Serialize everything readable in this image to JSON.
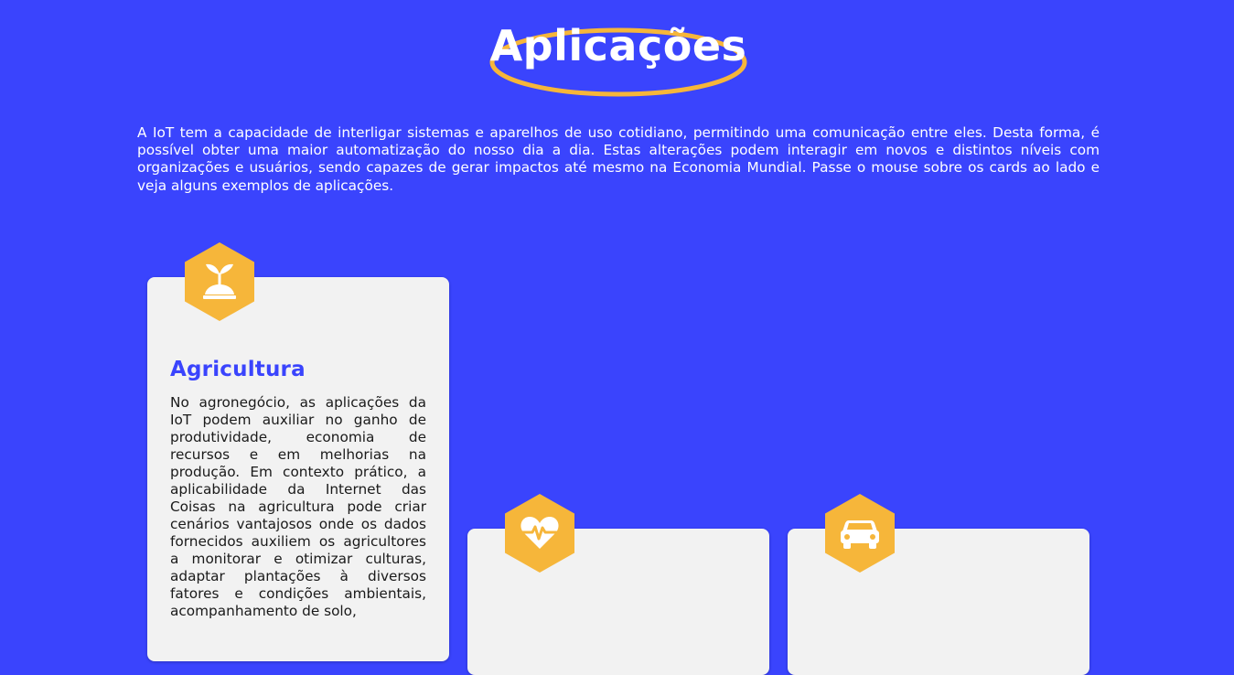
{
  "section": {
    "title": "Aplicações",
    "intro": "A IoT tem a capacidade de interligar sistemas e aparelhos de uso cotidiano, permitindo uma comunicação entre eles. Desta forma, é possível obter uma maior automatização do nosso dia a dia. Estas alterações podem interagir em novos e distintos níveis com organizações e usuários, sendo capazes de gerar impactos até mesmo na Economia Mundial. Passe o mouse sobre os cards ao lado e veja alguns exemplos de aplicações."
  },
  "cards": [
    {
      "icon": "sprout-icon",
      "title": "Agricultura",
      "text": "No agronegócio, as aplicações da IoT podem auxiliar no ganho de produtividade, economia de recursos e em melhorias na produção. Em contexto prático, a aplicabilidade da Internet das Coisas na agricultura pode criar cenários vantajosos onde os dados fornecidos auxiliem os agricultores a monitorar e otimizar culturas, adaptar plantações à diversos fatores e condições ambientais, acompanhamento de solo,"
    },
    {
      "icon": "heart-pulse-icon"
    },
    {
      "icon": "car-icon"
    }
  ],
  "colors": {
    "background": "#3a44fd",
    "accent": "#f6b63a",
    "card": "#f2f2f2",
    "card_title": "#3a44fd"
  }
}
